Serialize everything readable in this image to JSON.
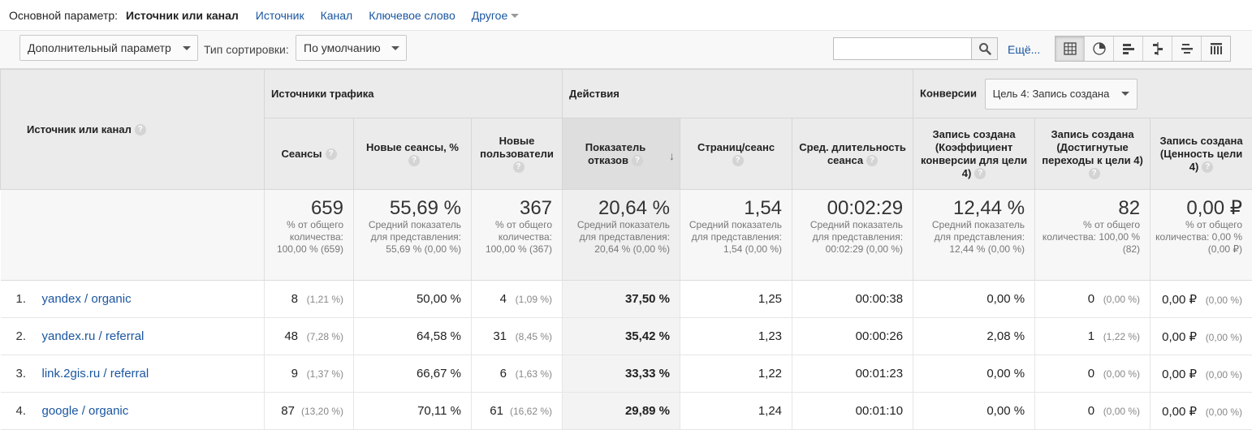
{
  "primary": {
    "label": "Основной параметр:",
    "current": "Источник или канал",
    "links": [
      "Источник",
      "Канал",
      "Ключевое слово",
      "Другое"
    ]
  },
  "toolbar": {
    "secondary_dim": "Дополнительный параметр",
    "sort_label": "Тип сортировки:",
    "sort_value": "По умолчанию",
    "search_value": "",
    "more": "Ещё..."
  },
  "table": {
    "dim_header": "Источник или канал",
    "groups": {
      "acquisition": "Источники трафика",
      "behavior": "Действия",
      "conversions": "Конверсии"
    },
    "goal_select": "Цель 4: Запись создана",
    "col_sessions": "Сеансы",
    "col_new_sessions": "Новые сеансы, %",
    "col_new_users": "Новые пользователи",
    "col_bounce": "Показатель отказов",
    "col_pages": "Страниц/сеанс",
    "col_duration": "Сред. длительность сеанса",
    "col_conv_rate": "Запись создана (Коэффициент конверсии для цели 4)",
    "col_completions": "Запись создана (Достигнутые переходы к цели 4)",
    "col_value": "Запись создана (Ценность цели 4)",
    "totals": {
      "sessions": {
        "big": "659",
        "small": "% от общего количества: 100,00 % (659)"
      },
      "new_sessions": {
        "big": "55,69 %",
        "small": "Средний показатель для представления: 55,69 % (0,00 %)"
      },
      "new_users": {
        "big": "367",
        "small": "% от общего количества: 100,00 % (367)"
      },
      "bounce": {
        "big": "20,64 %",
        "small": "Средний показатель для представления: 20,64 % (0,00 %)"
      },
      "pages": {
        "big": "1,54",
        "small": "Средний показатель для представления: 1,54 (0,00 %)"
      },
      "duration": {
        "big": "00:02:29",
        "small": "Средний показатель для представления: 00:02:29 (0,00 %)"
      },
      "conv_rate": {
        "big": "12,44 %",
        "small": "Средний показатель для представления: 12,44 % (0,00 %)"
      },
      "completions": {
        "big": "82",
        "small": "% от общего количества: 100,00 % (82)"
      },
      "value": {
        "big": "0,00 ₽",
        "small": "% от общего количества: 0,00 % (0,00 ₽)"
      }
    },
    "rows": [
      {
        "idx": "1.",
        "dim": "yandex / organic",
        "sessions": "8",
        "sessions_pct": "(1,21 %)",
        "new_sessions": "50,00 %",
        "new_users": "4",
        "new_users_pct": "(1,09 %)",
        "bounce": "37,50 %",
        "pages": "1,25",
        "duration": "00:00:38",
        "conv_rate": "0,00 %",
        "completions": "0",
        "completions_pct": "(0,00 %)",
        "value": "0,00 ₽",
        "value_pct": "(0,00 %)"
      },
      {
        "idx": "2.",
        "dim": "yandex.ru / referral",
        "sessions": "48",
        "sessions_pct": "(7,28 %)",
        "new_sessions": "64,58 %",
        "new_users": "31",
        "new_users_pct": "(8,45 %)",
        "bounce": "35,42 %",
        "pages": "1,23",
        "duration": "00:00:26",
        "conv_rate": "2,08 %",
        "completions": "1",
        "completions_pct": "(1,22 %)",
        "value": "0,00 ₽",
        "value_pct": "(0,00 %)"
      },
      {
        "idx": "3.",
        "dim": "link.2gis.ru / referral",
        "sessions": "9",
        "sessions_pct": "(1,37 %)",
        "new_sessions": "66,67 %",
        "new_users": "6",
        "new_users_pct": "(1,63 %)",
        "bounce": "33,33 %",
        "pages": "1,22",
        "duration": "00:01:23",
        "conv_rate": "0,00 %",
        "completions": "0",
        "completions_pct": "(0,00 %)",
        "value": "0,00 ₽",
        "value_pct": "(0,00 %)"
      },
      {
        "idx": "4.",
        "dim": "google / organic",
        "sessions": "87",
        "sessions_pct": "(13,20 %)",
        "new_sessions": "70,11 %",
        "new_users": "61",
        "new_users_pct": "(16,62 %)",
        "bounce": "29,89 %",
        "pages": "1,24",
        "duration": "00:01:10",
        "conv_rate": "0,00 %",
        "completions": "0",
        "completions_pct": "(0,00 %)",
        "value": "0,00 ₽",
        "value_pct": "(0,00 %)"
      }
    ]
  }
}
